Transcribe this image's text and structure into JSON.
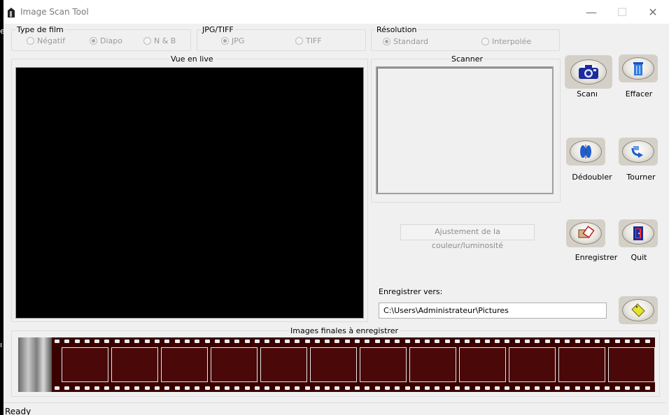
{
  "window": {
    "title": "Image Scan Tool",
    "controls": {
      "minimize": "—",
      "maximize": "☐",
      "close": "✕"
    }
  },
  "film_type": {
    "label": "Type de film",
    "options": [
      {
        "label": "Négatif",
        "checked": false
      },
      {
        "label": "Diapo",
        "checked": true
      },
      {
        "label": "N & B",
        "checked": false
      }
    ]
  },
  "format": {
    "label": "JPG/TIFF",
    "options": [
      {
        "label": "JPG",
        "checked": true
      },
      {
        "label": "TIFF",
        "checked": false
      }
    ]
  },
  "resolution": {
    "label": "Résolution",
    "options": [
      {
        "label": "Standard",
        "checked": true
      },
      {
        "label": "Interpolée",
        "checked": false
      }
    ]
  },
  "live_view": {
    "label": "Vue en live"
  },
  "scanner": {
    "label": "Scanner"
  },
  "adjust_button": "Ajustement de la couleur/luminosité",
  "save_to": {
    "label": "Enregistrer vers:",
    "path": "C:\\Users\\Administrateur\\Pictures"
  },
  "buttons": {
    "scan": "Scanı",
    "clear": "Effacer",
    "split": "Dédoubler",
    "rotate": "Tourner",
    "save": "Enregistrer",
    "quit": "Quit"
  },
  "final_images": {
    "label": "Images finales à enregistrer",
    "frame_count": 12
  },
  "status": "Ready",
  "colors": {
    "title_bar": "#ffffff",
    "client_bg": "#f0f0f0",
    "film_strip": "#3a0000",
    "frame_fill": "#4a0808"
  }
}
